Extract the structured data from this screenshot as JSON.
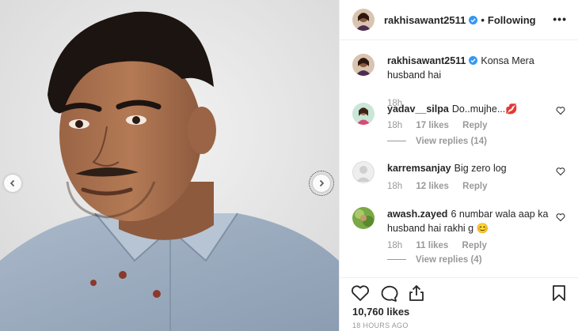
{
  "post": {
    "username": "rakhisawant2511",
    "separator": "•",
    "follow_status": "Following",
    "more_label": "•••"
  },
  "caption": {
    "username": "rakhisawant2511",
    "text": "Konsa Mera husband hai",
    "time": "18h"
  },
  "comments": [
    {
      "username": "yadav__silpa",
      "text": "Do..mujhe...💋",
      "time": "18h",
      "likes": "17 likes",
      "reply": "Reply",
      "view_replies": "View replies (14)"
    },
    {
      "username": "karremsanjay",
      "text": "Big zero log",
      "time": "18h",
      "likes": "12 likes",
      "reply": "Reply"
    },
    {
      "username": "awash.zayed",
      "text": "6 numbar wala aap ka husband hai rakhi g 😊",
      "time": "18h",
      "likes": "11 likes",
      "reply": "Reply",
      "view_replies": "View replies (4)"
    }
  ],
  "footer": {
    "likes": "10,760 likes",
    "timestamp": "18 HOURS AGO"
  },
  "icons": {
    "verified": "verified-badge-icon",
    "heart": "heart-icon",
    "comment": "comment-icon",
    "share": "share-icon",
    "save": "bookmark-icon",
    "prev": "chevron-left-icon",
    "next": "chevron-right-icon"
  },
  "colors": {
    "verified": "#3897f0",
    "muted": "#999999",
    "text": "#262626"
  }
}
